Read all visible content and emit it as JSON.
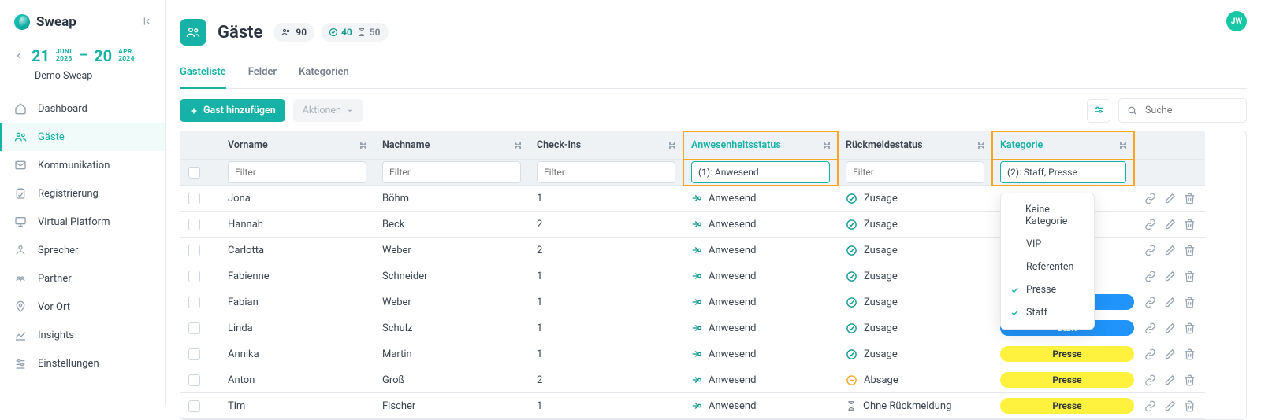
{
  "brand": {
    "name": "Sweap"
  },
  "event": {
    "name": "Demo Sweap",
    "start_day": "21",
    "start_mon": "JUNI",
    "start_year": "2023",
    "end_day": "20",
    "end_mon": "APR.",
    "end_year": "2024"
  },
  "sidebar": {
    "items": [
      {
        "label": "Dashboard"
      },
      {
        "label": "Gäste"
      },
      {
        "label": "Kommunikation"
      },
      {
        "label": "Registrierung"
      },
      {
        "label": "Virtual Platform"
      },
      {
        "label": "Sprecher"
      },
      {
        "label": "Partner"
      },
      {
        "label": "Vor Ort"
      },
      {
        "label": "Insights"
      },
      {
        "label": "Einstellungen"
      }
    ]
  },
  "page": {
    "title": "Gäste",
    "stats": {
      "total": "90",
      "accepted": "40",
      "pending": "50"
    }
  },
  "tabs": [
    {
      "label": "Gästeliste"
    },
    {
      "label": "Felder"
    },
    {
      "label": "Kategorien"
    }
  ],
  "toolbar": {
    "add_label": "Gast hinzufügen",
    "actions_label": "Aktionen",
    "search_placeholder": "Suche"
  },
  "user": {
    "initials": "JW"
  },
  "columns": {
    "vorname": "Vorname",
    "nachname": "Nachname",
    "checkins": "Check-ins",
    "attendance": "Anwesenheitsstatus",
    "response": "Rückmeldestatus",
    "category": "Kategorie",
    "filter_placeholder": "Filter",
    "attendance_filter": "(1): Anwesend",
    "category_filter": "(2): Staff, Presse"
  },
  "dropdown": {
    "items": [
      {
        "label": "Keine Kategorie",
        "selected": false
      },
      {
        "label": "VIP",
        "selected": false
      },
      {
        "label": "Referenten",
        "selected": false
      },
      {
        "label": "Presse",
        "selected": true
      },
      {
        "label": "Staff",
        "selected": true
      }
    ]
  },
  "status_labels": {
    "anwesend": "Anwesend",
    "zusage": "Zusage",
    "absage": "Absage",
    "ohne": "Ohne Rückmeldung"
  },
  "rows": [
    {
      "vorname": "Jona",
      "nachname": "Böhm",
      "checkins": "1",
      "attendance": "anwesend",
      "response": "zusage",
      "category": ""
    },
    {
      "vorname": "Hannah",
      "nachname": "Beck",
      "checkins": "2",
      "attendance": "anwesend",
      "response": "zusage",
      "category": ""
    },
    {
      "vorname": "Carlotta",
      "nachname": "Weber",
      "checkins": "2",
      "attendance": "anwesend",
      "response": "zusage",
      "category": ""
    },
    {
      "vorname": "Fabienne",
      "nachname": "Schneider",
      "checkins": "1",
      "attendance": "anwesend",
      "response": "zusage",
      "category": ""
    },
    {
      "vorname": "Fabian",
      "nachname": "Weber",
      "checkins": "1",
      "attendance": "anwesend",
      "response": "zusage",
      "category": "Staff"
    },
    {
      "vorname": "Linda",
      "nachname": "Schulz",
      "checkins": "1",
      "attendance": "anwesend",
      "response": "zusage",
      "category": "Staff"
    },
    {
      "vorname": "Annika",
      "nachname": "Martin",
      "checkins": "1",
      "attendance": "anwesend",
      "response": "zusage",
      "category": "Presse"
    },
    {
      "vorname": "Anton",
      "nachname": "Groß",
      "checkins": "2",
      "attendance": "anwesend",
      "response": "absage",
      "category": "Presse"
    },
    {
      "vorname": "Tim",
      "nachname": "Fischer",
      "checkins": "1",
      "attendance": "anwesend",
      "response": "ohne",
      "category": "Presse"
    }
  ]
}
